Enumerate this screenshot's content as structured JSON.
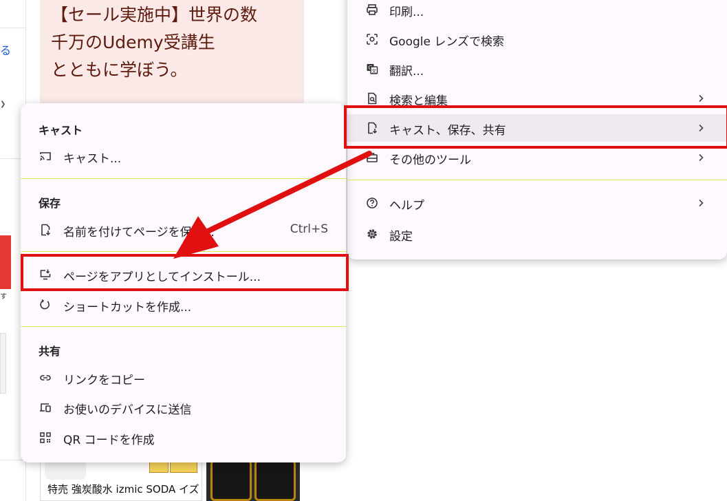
{
  "background": {
    "left_link_char": "る",
    "left_small_text": "す",
    "promo": {
      "line1": "【セール実施中】世界の数",
      "line2": "千万のUdemy受講生",
      "line3": "とともに学ぼう。"
    },
    "product_caption": "特売 強炭酸水 izmic SODA イズミックソーダ"
  },
  "main_menu": {
    "items": [
      {
        "label": "印刷...",
        "icon": "print-icon"
      },
      {
        "label": "Google レンズで検索",
        "icon": "lens-icon"
      },
      {
        "label": "翻訳...",
        "icon": "translate-icon"
      },
      {
        "label": "検索と編集",
        "icon": "find-icon",
        "has_submenu": true
      },
      {
        "label": "キャスト、保存、共有",
        "icon": "save-share-icon",
        "has_submenu": true,
        "highlighted": true
      },
      {
        "label": "その他のツール",
        "icon": "toolbox-icon",
        "has_submenu": true
      },
      {
        "label": "ヘルプ",
        "icon": "help-icon",
        "has_submenu": true
      },
      {
        "label": "設定",
        "icon": "settings-icon"
      }
    ]
  },
  "submenu": {
    "cast_title": "キャスト",
    "cast_item": "キャスト...",
    "save_title": "保存",
    "save_page": "名前を付けてページを保存...",
    "save_page_shortcut": "Ctrl+S",
    "install_app": "ページをアプリとしてインストール...",
    "create_shortcut": "ショートカットを作成...",
    "share_title": "共有",
    "copy_link": "リンクをコピー",
    "send_to_devices": "お使いのデバイスに送信",
    "qr_code": "QR コードを作成"
  },
  "colors": {
    "annotation_red": "#e01010",
    "menu_bg": "#fdf9ff",
    "highlight_bg": "#efeaf0",
    "separator": "#e2e860"
  }
}
